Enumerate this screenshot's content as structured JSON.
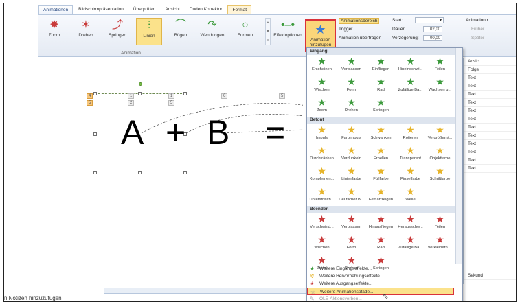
{
  "ribbon": {
    "tabs": [
      "Animationen",
      "Bildschirmpräsentation",
      "Überprüfen",
      "Ansicht",
      "Duden Korrektor",
      "Format"
    ],
    "buttons": [
      {
        "label": "Zoom",
        "icon": "zoom-star-icon"
      },
      {
        "label": "Drehen",
        "icon": "spin-star-icon"
      },
      {
        "label": "Springen",
        "icon": "bounce-icon"
      },
      {
        "label": "Linien",
        "icon": "line-path-icon"
      },
      {
        "label": "Bögen",
        "icon": "arc-path-icon"
      },
      {
        "label": "Wendungen",
        "icon": "turn-path-icon"
      },
      {
        "label": "Formen",
        "icon": "shape-path-icon"
      }
    ],
    "group_label": "Animation",
    "effect_options": "Effektoptionen",
    "add_animation": "Animation hinzufügen",
    "animation_pane": "Animationsbereich",
    "trigger": "Trigger",
    "anim_painter": "Animation übertragen",
    "start_label": "Start:",
    "duration_label": "Dauer:",
    "duration_value": "02,00",
    "delay_label": "Verzögerung:",
    "delay_value": "00,00",
    "earlier": "Früher",
    "later": "Später",
    "anim_r": "Animation r"
  },
  "slide": {
    "text_a": "A",
    "text_plus": "+",
    "text_b": "B",
    "text_eq": "=",
    "tags": [
      "4",
      "5",
      "1",
      "2",
      "1",
      "5",
      "6",
      "5"
    ]
  },
  "notes_placeholder": "n Notizen hinzuzufügen",
  "pane": {
    "rows": [
      "Ansic",
      "Folge",
      "Text",
      "Text",
      "Text",
      "Text",
      "Text",
      "Text",
      "Text",
      "Text",
      "Text",
      "Text",
      "Text",
      "Text"
    ],
    "bottom": "Sekund"
  },
  "gallery": {
    "sections": [
      {
        "title": "Eingang",
        "color": "#3c9a3c",
        "items": [
          "Erscheinen",
          "Verblassen",
          "Einfliegen",
          "Hineinschwi...",
          "Teilen",
          "Wischen",
          "Form",
          "Rad",
          "Zufällige Ba...",
          "Wachsen u...",
          "Zoom",
          "Drehen",
          "Springen"
        ]
      },
      {
        "title": "Betont",
        "color": "#e6b42a",
        "items": [
          "Impuls",
          "Farbimpuls",
          "Schwanken",
          "Rotieren",
          "Vergrößern/...",
          "Durchtränken",
          "Verdunkeln",
          "Erhellen",
          "Transparent",
          "Objektfarbe",
          "Komplemen...",
          "Linienfarbe",
          "Füllfarbe",
          "Pinselfarbe",
          "Schriftfarbe",
          "Unterstreich...",
          "Deutlicher B...",
          "Fett anzeigen",
          "Welle"
        ]
      },
      {
        "title": "Beenden",
        "color": "#c83a3a",
        "items": [
          "Verschwind...",
          "Verblassen",
          "Hinausfliegen",
          "Herausschw...",
          "Teilen",
          "Wischen",
          "Form",
          "Rad",
          "Zufällige Ba...",
          "Verkleinern ...",
          "Zoom",
          "Drehen",
          "Springen"
        ]
      }
    ],
    "links": [
      {
        "label": "Weitere Eingangseffekte...",
        "icon": "green-star-icon"
      },
      {
        "label": "Weitere Hervorhebungseffekte...",
        "icon": "yellow-star-icon"
      },
      {
        "label": "Weitere Ausgangseffekte...",
        "icon": "red-star-icon"
      },
      {
        "label": "Weitere Animationspfade...",
        "icon": "path-star-icon"
      },
      {
        "label": "OLE-Aktionsverben...",
        "icon": "ole-icon"
      }
    ]
  }
}
